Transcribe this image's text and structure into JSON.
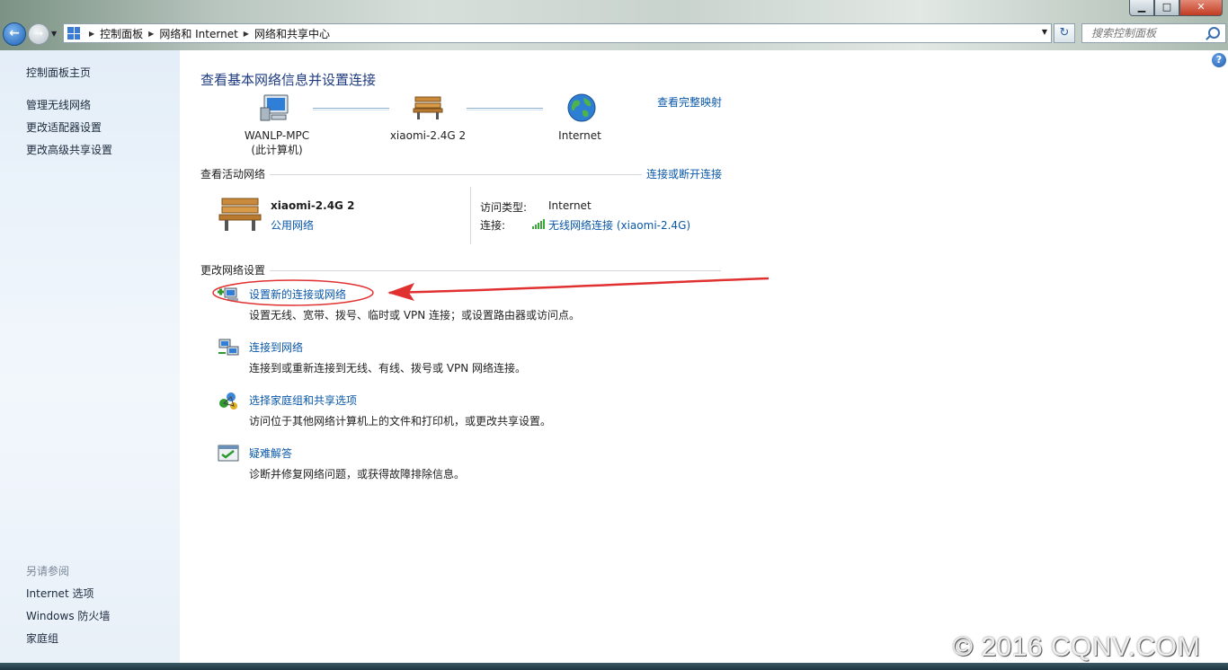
{
  "window": {
    "controls": {
      "minimize": "▁",
      "maximize": "□",
      "close": "✕"
    }
  },
  "toolbar": {
    "breadcrumbs": [
      "控制面板",
      "网络和 Internet",
      "网络和共享中心"
    ],
    "search_placeholder": "搜索控制面板"
  },
  "sidebar": {
    "home": "控制面板主页",
    "items": [
      "管理无线网络",
      "更改适配器设置",
      "更改高级共享设置"
    ],
    "see_also_title": "另请参阅",
    "see_also": [
      "Internet 选项",
      "Windows 防火墙",
      "家庭组"
    ]
  },
  "main": {
    "title": "查看基本网络信息并设置连接",
    "view_full_map": "查看完整映射",
    "map_nodes": [
      {
        "name": "WANLP-MPC",
        "sub": "(此计算机)",
        "icon": "computer-icon"
      },
      {
        "name": "xiaomi-2.4G  2",
        "sub": "",
        "icon": "bench-network-icon"
      },
      {
        "name": "Internet",
        "sub": "",
        "icon": "globe-icon"
      }
    ],
    "active_networks_title": "查看活动网络",
    "connect_disconnect": "连接或断开连接",
    "active_network": {
      "name": "xiaomi-2.4G  2",
      "type": "公用网络",
      "access_type_label": "访问类型:",
      "access_type_value": "Internet",
      "connection_label": "连接:",
      "connection_value": "无线网络连接 (xiaomi-2.4G)"
    },
    "change_settings_title": "更改网络设置",
    "tasks": [
      {
        "title": "设置新的连接或网络",
        "desc": "设置无线、宽带、拨号、临时或 VPN 连接；或设置路由器或访问点。",
        "icon": "new-connection-icon"
      },
      {
        "title": "连接到网络",
        "desc": "连接到或重新连接到无线、有线、拨号或 VPN 网络连接。",
        "icon": "connect-network-icon"
      },
      {
        "title": "选择家庭组和共享选项",
        "desc": "访问位于其他网络计算机上的文件和打印机，或更改共享设置。",
        "icon": "homegroup-icon"
      },
      {
        "title": "疑难解答",
        "desc": "诊断并修复网络问题，或获得故障排除信息。",
        "icon": "troubleshoot-icon"
      }
    ]
  },
  "annotation": {
    "color": "#e03030"
  },
  "watermark": "© 2016 CQNV.COM",
  "colors": {
    "link": "#0a58a8",
    "title": "#1e3b80"
  }
}
